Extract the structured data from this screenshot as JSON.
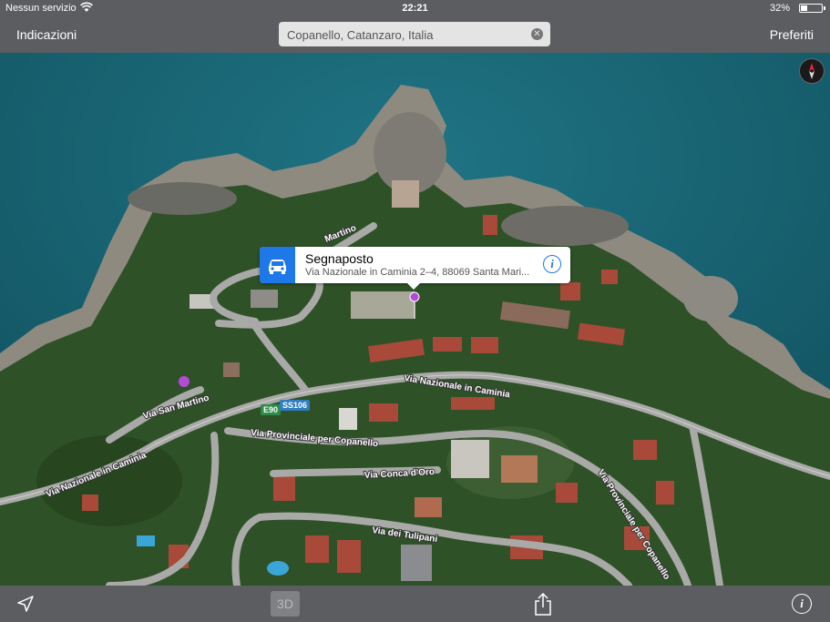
{
  "status_bar": {
    "carrier": "Nessun servizio",
    "time": "22:21",
    "battery": "32%",
    "battery_level": 0.32
  },
  "nav": {
    "directions_label": "Indicazioni",
    "favorites_label": "Preferiti",
    "search_value": "Copanello, Catanzaro, Italia"
  },
  "map": {
    "roads": {
      "martino_top": "Martino",
      "nazionale_right": "Via Nazionale in Caminia",
      "san_martino": "Via San Martino",
      "nazionale_left": "Via Nazionale in Caminia",
      "provinciale_center": "Via Provinciale per Copanello",
      "conca_doro": "Via Conca d'Oro",
      "tulipani": "Via dei Tulipani",
      "provinciale_right": "Via Provinciale per Copanello"
    },
    "shields": {
      "e90": "E90",
      "ss106": "SS106"
    },
    "colors": {
      "sea": "#1b6a78",
      "vegetation": "#2f5128",
      "pin": "#b44ad8",
      "accent": "#1e78e8"
    }
  },
  "callout": {
    "title": "Segnaposto",
    "address": "Via Nazionale in Caminia 2–4, 88069 Santa Mari..."
  },
  "toolbar": {
    "three_d_label": "3D"
  }
}
